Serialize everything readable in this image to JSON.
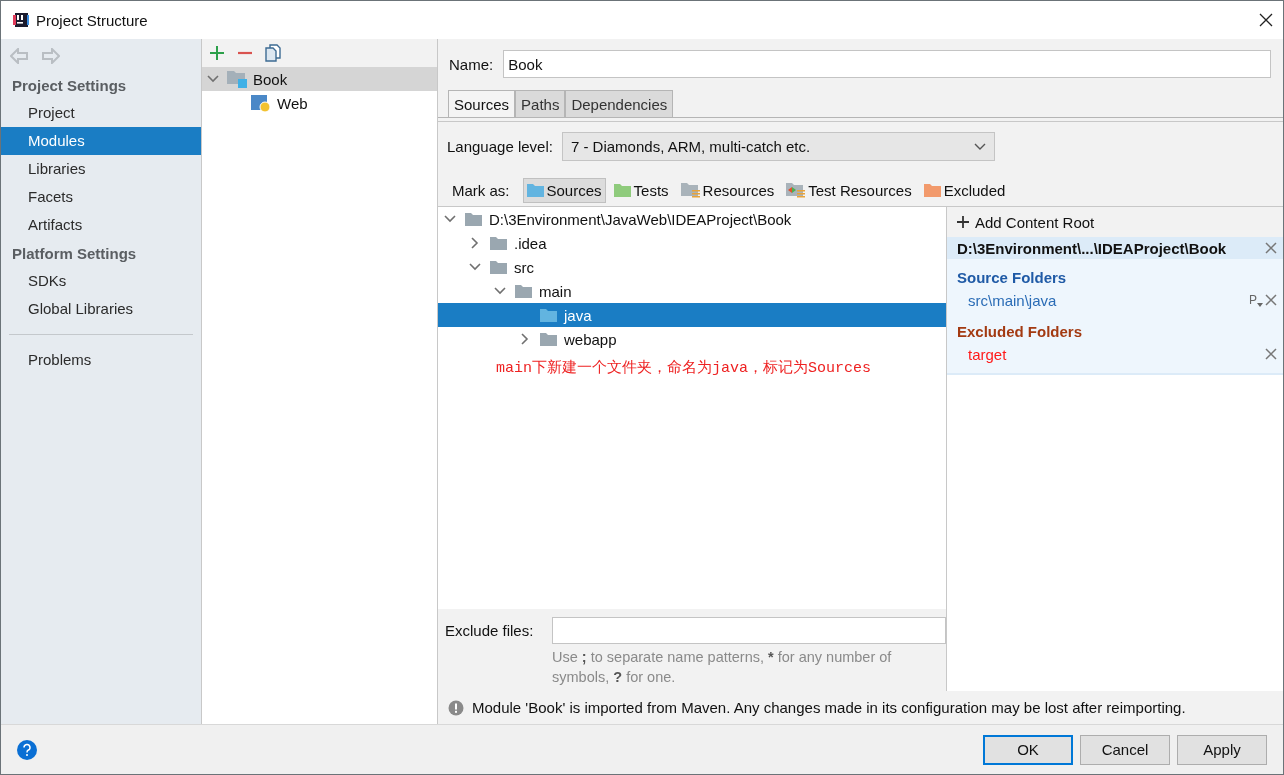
{
  "window": {
    "title": "Project Structure"
  },
  "sidebar": {
    "sections": [
      {
        "title": "Project Settings",
        "items": [
          {
            "label": "Project",
            "selected": false
          },
          {
            "label": "Modules",
            "selected": true
          },
          {
            "label": "Libraries",
            "selected": false
          },
          {
            "label": "Facets",
            "selected": false
          },
          {
            "label": "Artifacts",
            "selected": false
          }
        ]
      },
      {
        "title": "Platform Settings",
        "items": [
          {
            "label": "SDKs",
            "selected": false
          },
          {
            "label": "Global Libraries",
            "selected": false
          }
        ]
      }
    ],
    "bottom_items": [
      {
        "label": "Problems",
        "selected": false
      }
    ]
  },
  "modules": {
    "tree": [
      {
        "label": "Book",
        "kind": "module",
        "expanded": true,
        "selected": true,
        "children": [
          {
            "label": "Web",
            "kind": "web",
            "selected": false
          }
        ]
      }
    ]
  },
  "editor": {
    "name_label": "Name:",
    "name_value": "Book",
    "tabs": [
      {
        "label": "Sources",
        "selected": true
      },
      {
        "label": "Paths",
        "selected": false
      },
      {
        "label": "Dependencies",
        "selected": false
      }
    ],
    "language_level": {
      "label": "Language level:",
      "value": "7 - Diamonds, ARM, multi-catch etc."
    },
    "mark_as": {
      "label": "Mark as:",
      "options": [
        {
          "label": "Sources",
          "kind": "sources",
          "selected": true
        },
        {
          "label": "Tests",
          "kind": "tests",
          "selected": false
        },
        {
          "label": "Resources",
          "kind": "resources",
          "selected": false
        },
        {
          "label": "Test Resources",
          "kind": "test_resources",
          "selected": false
        },
        {
          "label": "Excluded",
          "kind": "excluded",
          "selected": false
        }
      ]
    },
    "content_tree": [
      {
        "label": "D:\\3Environment\\JavaWeb\\IDEAProject\\Book",
        "kind": "plain",
        "expanded": true,
        "selected": false,
        "children": [
          {
            "label": ".idea",
            "kind": "plain",
            "expanded": false,
            "selected": false
          },
          {
            "label": "src",
            "kind": "plain",
            "expanded": true,
            "selected": false,
            "children": [
              {
                "label": "main",
                "kind": "plain",
                "expanded": true,
                "selected": false,
                "children": [
                  {
                    "label": "java",
                    "kind": "sources",
                    "selected": true
                  },
                  {
                    "label": "webapp",
                    "kind": "plain",
                    "expanded": false,
                    "selected": false
                  }
                ]
              }
            ]
          }
        ]
      }
    ],
    "annotation": "main下新建一个文件夹，命名为java，标记为Sources",
    "exclude_files": {
      "label": "Exclude files:"
    },
    "exclude_hint": "Use **;** to separate name patterns, ***** for any number of symbols, **?** for one.",
    "content_roots": {
      "add_label": "Add Content Root",
      "root": "D:\\3Environment\\...\\IDEAProject\\Book",
      "sections": [
        {
          "kind": "sources",
          "title": "Source Folders",
          "items": [
            {
              "path": "src\\main\\java",
              "badge": "P"
            }
          ]
        },
        {
          "kind": "excluded",
          "title": "Excluded Folders",
          "items": [
            {
              "path": "target"
            }
          ]
        }
      ]
    },
    "message": "Module 'Book' is imported from Maven. Any changes made in its configuration may be lost after reimporting."
  },
  "buttons": [
    {
      "label": "OK",
      "kind": "default"
    },
    {
      "label": "Cancel",
      "kind": "normal"
    },
    {
      "label": "Apply",
      "kind": "normal"
    }
  ]
}
